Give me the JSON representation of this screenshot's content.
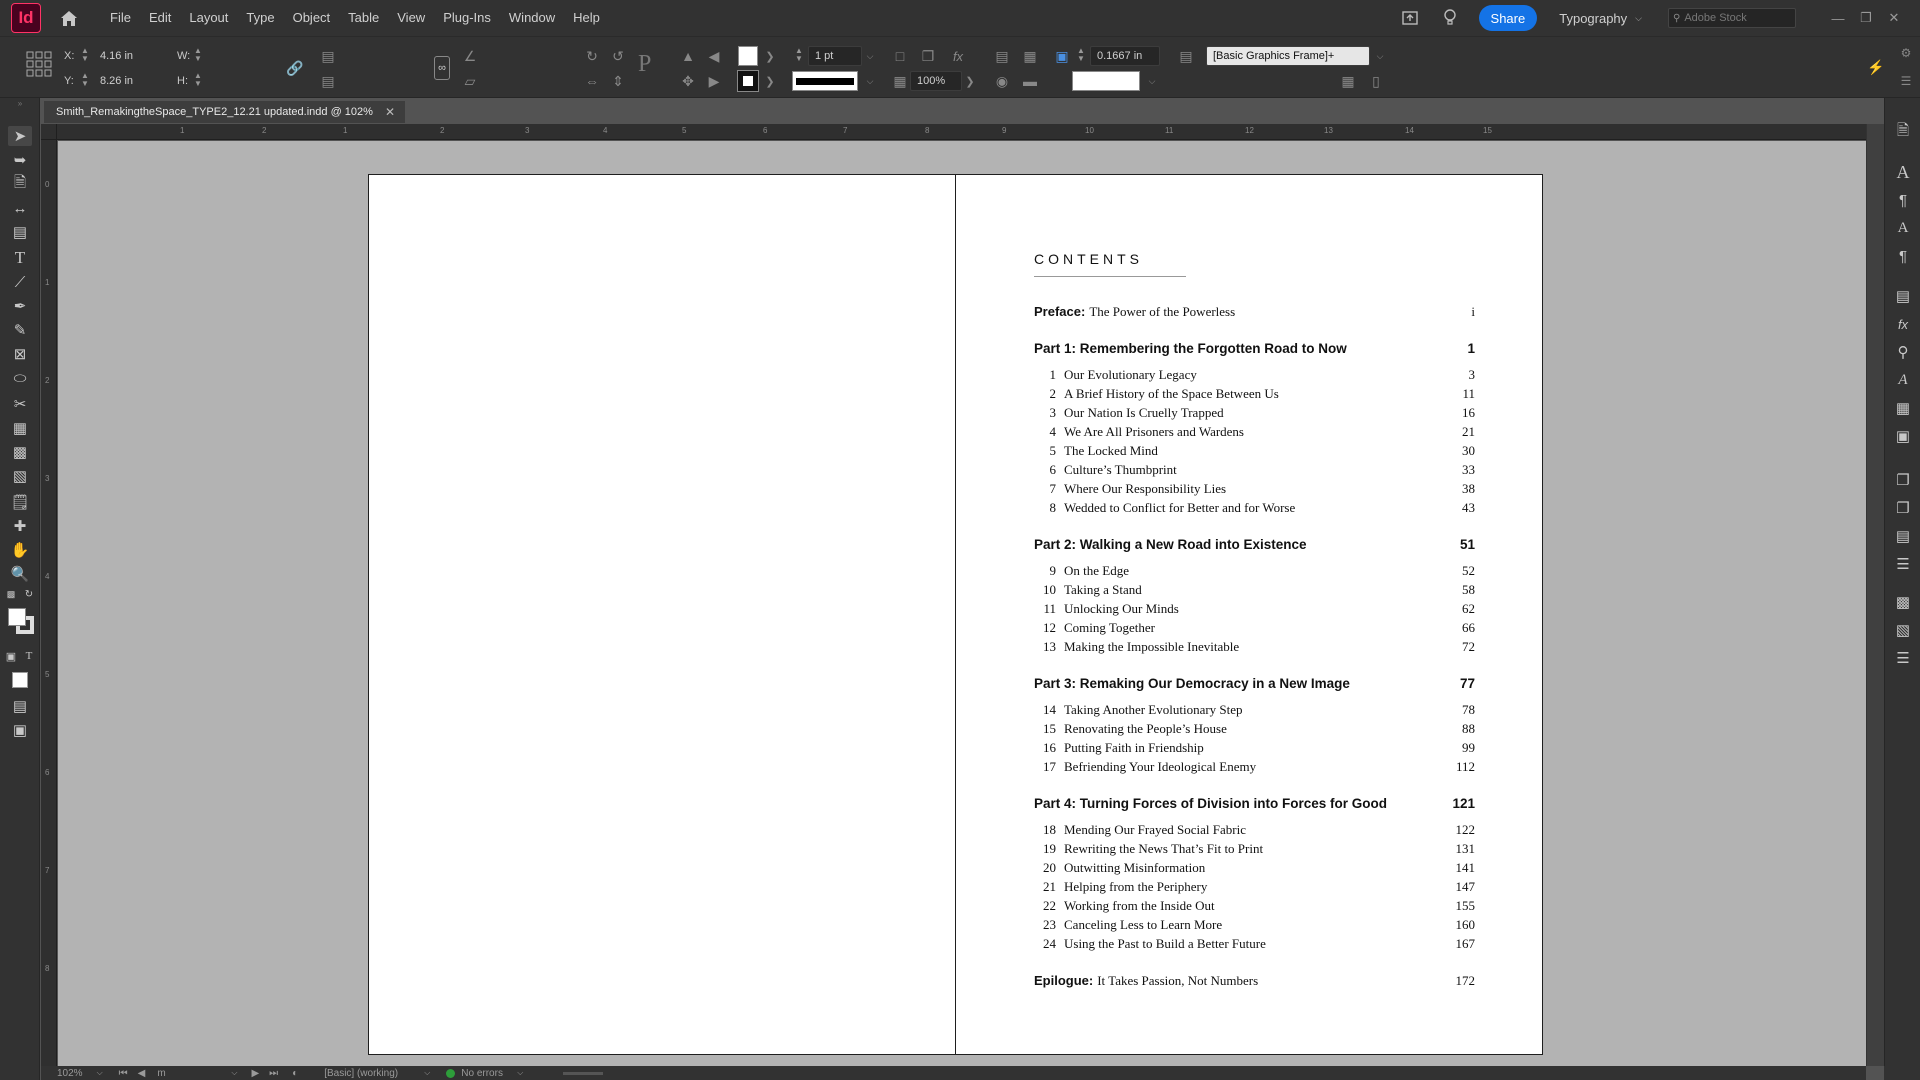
{
  "app": {
    "logo": "Id"
  },
  "menu": [
    "File",
    "Edit",
    "Layout",
    "Type",
    "Object",
    "Table",
    "View",
    "Plug-Ins",
    "Window",
    "Help"
  ],
  "topright": {
    "share": "Share",
    "workspace": "Typography",
    "stock_placeholder": "Adobe Stock"
  },
  "control": {
    "x_label": "X:",
    "x_value": "4.16 in",
    "y_label": "Y:",
    "y_value": "8.26 in",
    "w_label": "W:",
    "h_label": "H:",
    "stroke_weight": "1 pt",
    "opacity": "100%",
    "offset": "0.1667 in",
    "object_style": "[Basic Graphics Frame]+"
  },
  "document": {
    "tab_title": "Smith_RemakingtheSpace_TYPE2_12.21 updated.indd @ 102%"
  },
  "rulers": {
    "h": [
      "1",
      "2",
      "1",
      "2",
      "3",
      "4",
      "5",
      "6",
      "7",
      "8",
      "9",
      "10",
      "11",
      "12",
      "13",
      "14",
      "15"
    ],
    "v": [
      "0",
      "1",
      "2",
      "3",
      "4",
      "5",
      "6",
      "7",
      "8"
    ]
  },
  "contents": {
    "heading": "CONTENTS",
    "preface": {
      "label": "Preface:",
      "title": "The Power of the Powerless",
      "page": "i"
    },
    "parts": [
      {
        "title": "Part 1: Remembering the Forgotten Road to Now",
        "page": "1",
        "chapters": [
          {
            "num": "1",
            "title": "Our Evolutionary Legacy",
            "page": "3"
          },
          {
            "num": "2",
            "title": "A Brief History of the Space Between Us",
            "page": "11"
          },
          {
            "num": "3",
            "title": "Our Nation Is Cruelly Trapped",
            "page": "16"
          },
          {
            "num": "4",
            "title": "We Are All Prisoners and Wardens",
            "page": "21"
          },
          {
            "num": "5",
            "title": "The Locked Mind",
            "page": "30"
          },
          {
            "num": "6",
            "title": "Culture’s Thumbprint",
            "page": "33"
          },
          {
            "num": "7",
            "title": "Where Our Responsibility Lies",
            "page": "38"
          },
          {
            "num": "8",
            "title": "Wedded to Conflict for Better and for Worse",
            "page": "43"
          }
        ]
      },
      {
        "title": "Part 2: Walking a New Road into Existence",
        "page": "51",
        "chapters": [
          {
            "num": "9",
            "title": "On the Edge",
            "page": "52"
          },
          {
            "num": "10",
            "title": "Taking a Stand",
            "page": "58"
          },
          {
            "num": "11",
            "title": "Unlocking Our Minds",
            "page": "62"
          },
          {
            "num": "12",
            "title": "Coming Together",
            "page": "66"
          },
          {
            "num": "13",
            "title": "Making the Impossible Inevitable",
            "page": "72"
          }
        ]
      },
      {
        "title": "Part 3: Remaking Our Democracy in a New Image",
        "page": "77",
        "chapters": [
          {
            "num": "14",
            "title": "Taking Another Evolutionary Step",
            "page": "78"
          },
          {
            "num": "15",
            "title": "Renovating the People’s House",
            "page": "88"
          },
          {
            "num": "16",
            "title": "Putting Faith in Friendship",
            "page": "99"
          },
          {
            "num": "17",
            "title": "Befriending Your Ideological Enemy",
            "page": "112"
          }
        ]
      },
      {
        "title": "Part 4: Turning Forces of Division into Forces for Good",
        "page": "121",
        "chapters": [
          {
            "num": "18",
            "title": "Mending Our Frayed Social Fabric",
            "page": "122"
          },
          {
            "num": "19",
            "title": "Rewriting the News That’s Fit to Print",
            "page": "131"
          },
          {
            "num": "20",
            "title": "Outwitting Misinformation",
            "page": "141"
          },
          {
            "num": "21",
            "title": "Helping from the Periphery",
            "page": "147"
          },
          {
            "num": "22",
            "title": "Working from the Inside Out",
            "page": "155"
          },
          {
            "num": "23",
            "title": "Canceling Less to Learn More",
            "page": "160"
          },
          {
            "num": "24",
            "title": "Using the Past to Build a Better Future",
            "page": "167"
          }
        ]
      }
    ],
    "epilogue": {
      "label": "Epilogue:",
      "title": "It Takes Passion, Not Numbers",
      "page": "172"
    }
  },
  "status": {
    "zoom": "102%",
    "page": "m",
    "preflight_profile": "[Basic] (working)",
    "errors": "No errors"
  },
  "colors": {
    "share": "#1473e6",
    "app_accent": "#ff3366",
    "no_error": "#2d9d3a"
  }
}
